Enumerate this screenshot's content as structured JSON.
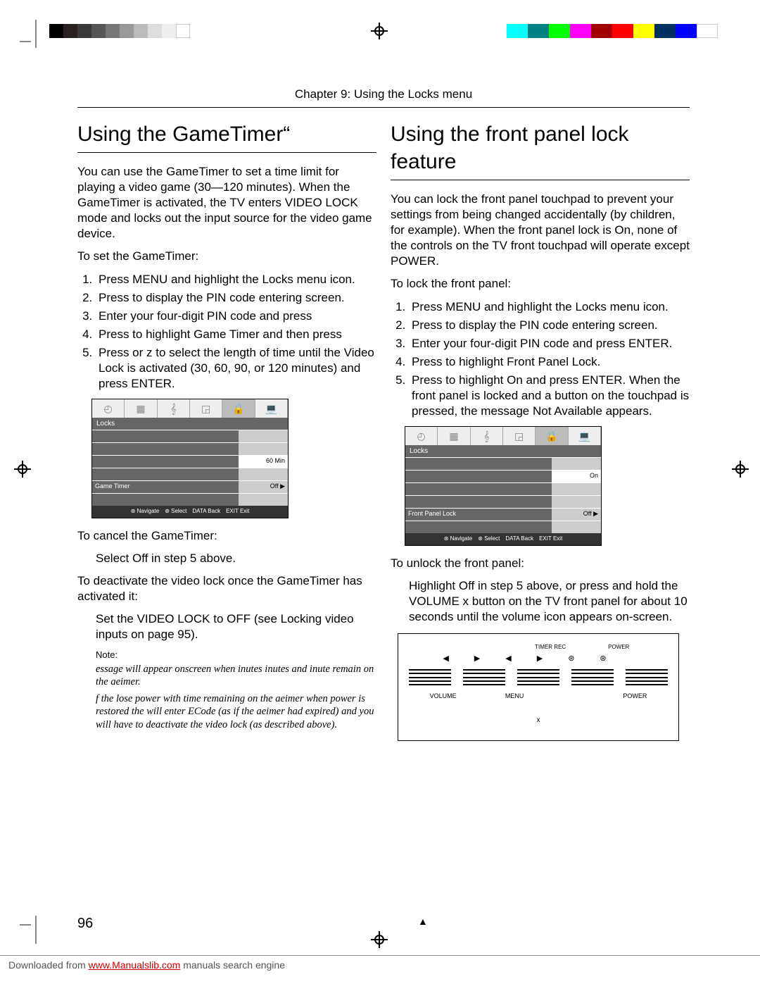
{
  "chapter": "Chapter 9: Using the Locks menu",
  "pageNumber": "96",
  "left": {
    "heading": "Using the GameTimer“",
    "intro": "You can use the GameTimer to set a time limit for playing a video game (30—120 minutes). When the GameTimer is activated, the TV enters VIDEO LOCK mode and locks out the input source for the video game device.",
    "setHeading": "To set the GameTimer:",
    "steps": [
      "Press MENU and highlight the Locks menu icon.",
      "Press  to display the PIN code entering screen.",
      "Enter your four-digit PIN code and press",
      "Press  to highlight Game Timer and then press",
      "Press  or z  to select the length of time until the Video Lock is activated (30, 60, 90, or 120 minutes) and press ENTER."
    ],
    "cancelHeading": "To cancel the GameTimer:",
    "cancelBody": "Select Off in step 5 above.",
    "deactivateHeading": "To deactivate the video lock once the GameTimer has activated it:",
    "deactivateBody": "Set the VIDEO LOCK to OFF (see  Locking video inputs  on page 95).",
    "noteLabel": "Note:",
    "note1": "essage will appear onscreen when  inutes  inutes and  inute remain on the aeimer.",
    "note2": "f the  lose power with time remaining on the aeimer when power is restored the  will enter  ECode (as if the aeimer had expired) and you will have to deactivate the video lock (as described above).",
    "osd": {
      "title": "Locks",
      "selectedRow": "Game Timer",
      "selectedVal": "Off   ▶",
      "popupVal": "60 Min",
      "foot": {
        "a": "⊛ Navigate",
        "b": "⊛ Select",
        "c": "DATA Back",
        "d": "EXIT Exit"
      }
    }
  },
  "right": {
    "heading": "Using the front panel lock feature",
    "intro": "You can lock the front panel touchpad to prevent your settings from being changed accidentally (by children, for example). When the front panel lock is On, none of the controls on the TV front touchpad will operate except POWER.",
    "setHeading": "To lock the front panel:",
    "steps": [
      "Press MENU and highlight the Locks menu icon.",
      "Press  to display the PIN code entering screen.",
      "Enter your four-digit PIN code and press ENTER.",
      "Press  to highlight Front Panel Lock.",
      "Press  to highlight On and press ENTER. When the front panel is locked and a button on the touchpad is pressed, the message  Not Available  appears."
    ],
    "unlockHeading": "To unlock the front panel:",
    "unlockBody": "Highlight Off in step 5 above, or press and hold the VOLUME x  button on the TV front panel for about 10 seconds until the volume icon appears on-screen.",
    "osd": {
      "title": "Locks",
      "selectedRow": "Front Panel Lock",
      "selectedVal": "Off   ▶",
      "popupVal": "On",
      "foot": {
        "a": "⊛ Navigate",
        "b": "⊛ Select",
        "c": "DATA Back",
        "d": "EXIT Exit"
      }
    },
    "fp": {
      "top1": "TIMER REC",
      "top2": "POWER",
      "label1": "VOLUME",
      "label2": "MENU",
      "label3": "POWER",
      "x": "x"
    }
  },
  "footer": {
    "pre": "Downloaded from ",
    "link": "www.Manualslib.com",
    "post": " manuals search engine"
  }
}
